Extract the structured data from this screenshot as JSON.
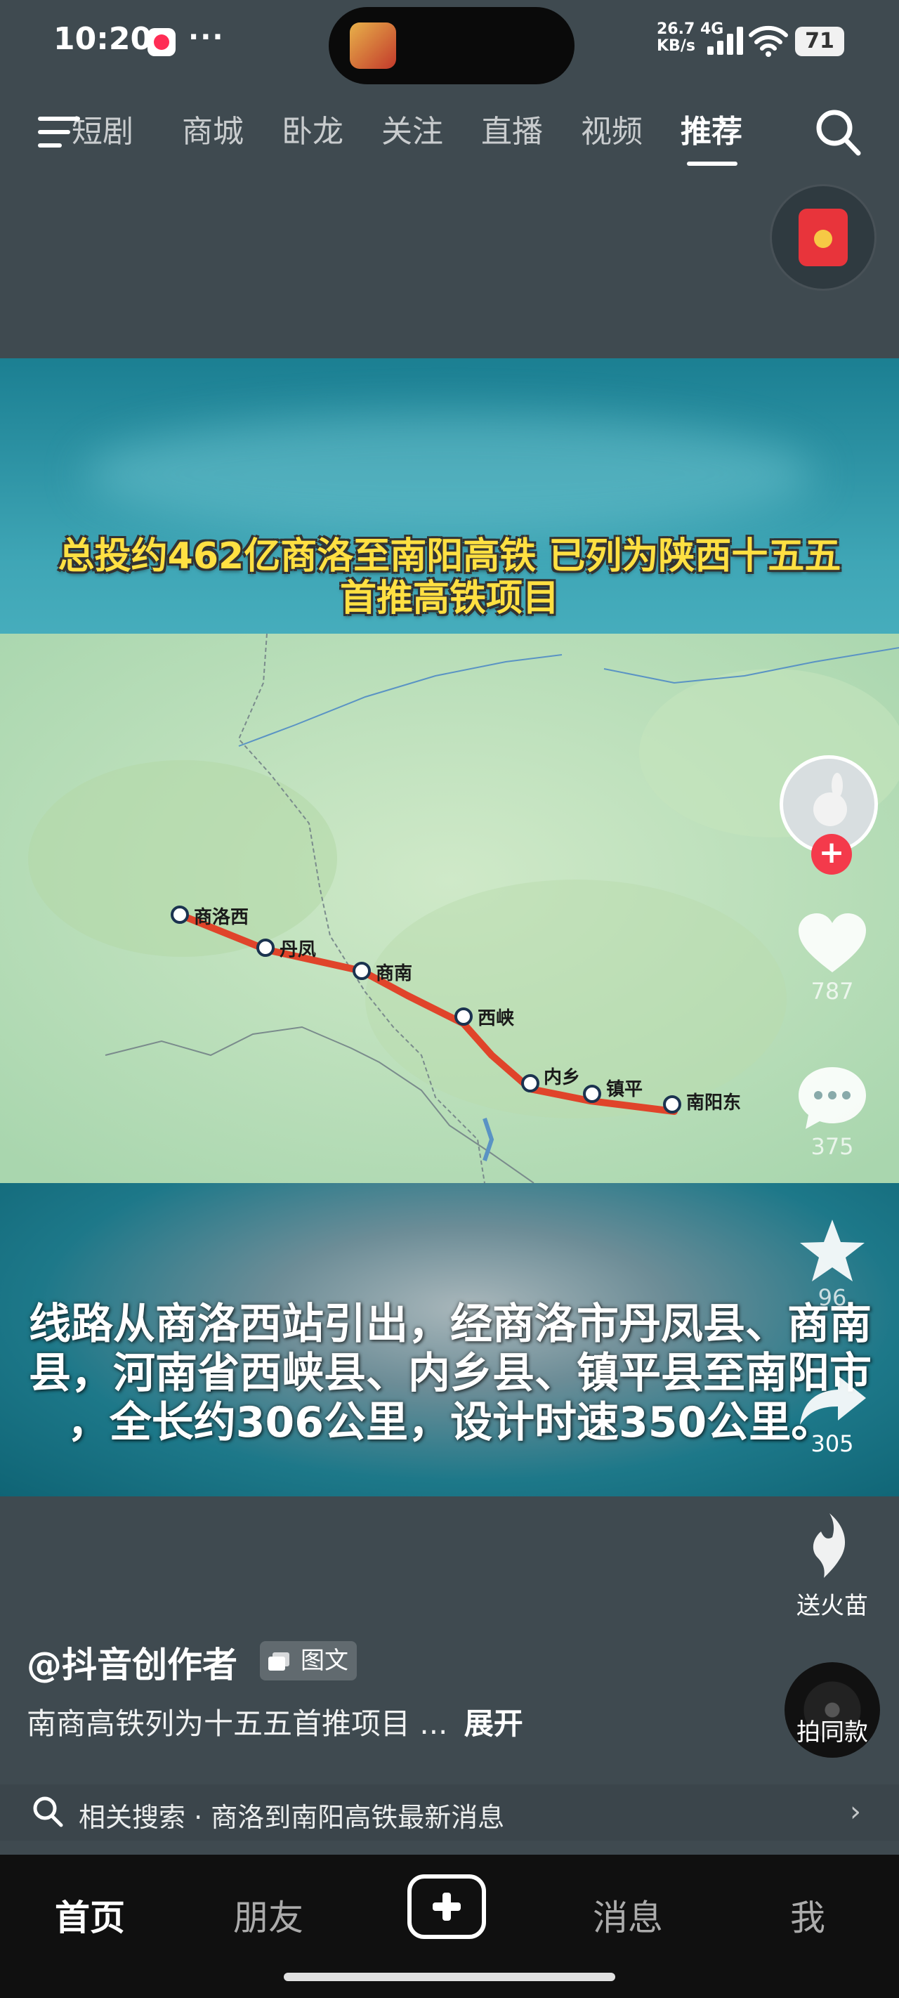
{
  "status_bar": {
    "time": "10:20",
    "more": "···",
    "net_speed_top": "26.7 4G",
    "net_speed_bottom": "KB/s",
    "battery": "71"
  },
  "top_nav": {
    "tabs": [
      {
        "label": "短剧"
      },
      {
        "label": "商城"
      },
      {
        "label": "卧龙"
      },
      {
        "label": "关注"
      },
      {
        "label": "直播"
      },
      {
        "label": "视频"
      },
      {
        "label": "推荐"
      }
    ],
    "active_tab": "推荐"
  },
  "post": {
    "headline_line1": "总投约462亿商洛至南阳高铁 已列为陕西十五五",
    "headline_line2": "首推高铁项目",
    "caption_line1": "线路从商洛西站引出，经商洛市丹凤县、商南",
    "caption_line2": "县，河南省西峡县、内乡县、镇平县至南阳市",
    "caption_line3": "，全长约306公里，设计时速350公里。",
    "map": {
      "route_color": "#e0442a",
      "stations": [
        "商洛西",
        "丹凤",
        "商南",
        "西峡",
        "内乡",
        "镇平",
        "南阳东"
      ]
    }
  },
  "actions": {
    "likes": "787",
    "comments": "375",
    "favorites": "96",
    "shares": "305",
    "fire_label": "送火苗",
    "same_label": "拍同款",
    "follow_plus": "+"
  },
  "info": {
    "author": "@抖音创作者",
    "type_tag": "图文",
    "description": "南商高铁列为十五五首推项目 ...",
    "expand": "展开",
    "related_search": "相关搜索 · 商洛到南阳高铁最新消息",
    "related_chevron": "›"
  },
  "bottom_tabs": {
    "home": "首页",
    "friends": "朋友",
    "messages": "消息",
    "me": "我"
  },
  "colors": {
    "accent_red": "#f43a4b",
    "headline_yellow": "#ffe042"
  }
}
